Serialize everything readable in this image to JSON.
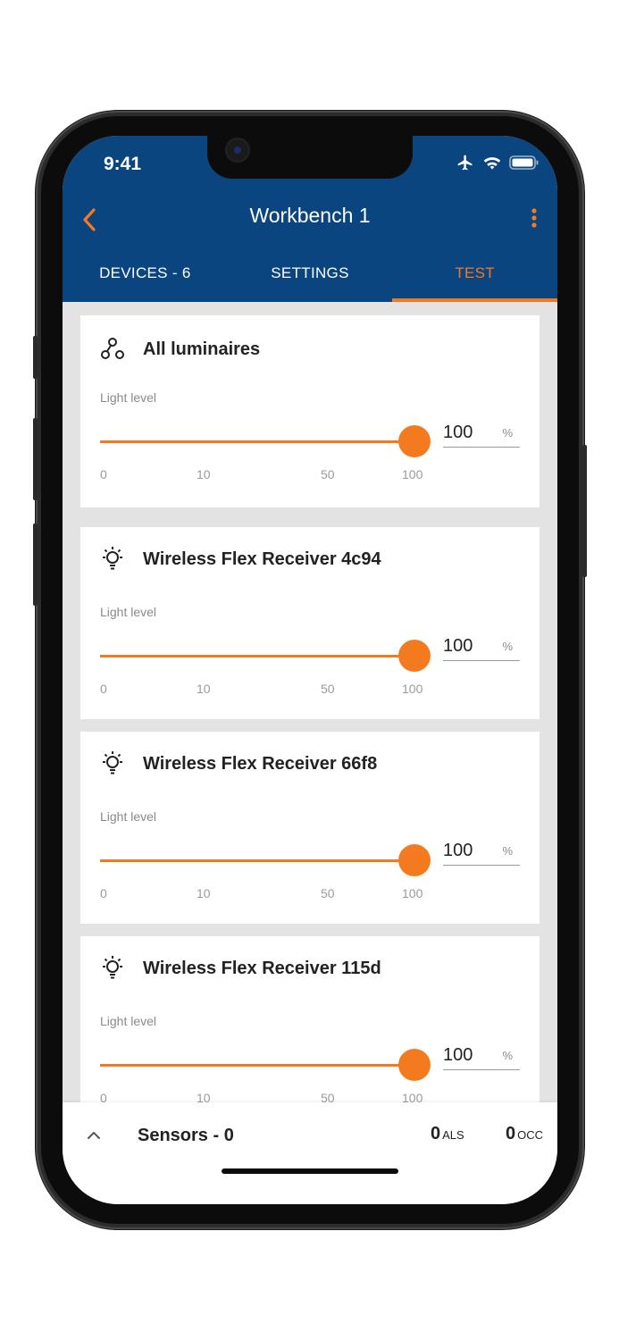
{
  "status_bar": {
    "time": "9:41"
  },
  "header": {
    "title": "Workbench 1"
  },
  "tabs": [
    {
      "label": "DEVICES - 6",
      "active": false
    },
    {
      "label": "SETTINGS",
      "active": false
    },
    {
      "label": "TEST",
      "active": true
    }
  ],
  "cards": [
    {
      "title": "All luminaires",
      "icon": "group-icon",
      "level_label": "Light level",
      "value": "100",
      "unit": "%",
      "ticks": [
        "0",
        "10",
        "50",
        "100"
      ],
      "level_percent": 100
    },
    {
      "title": "Wireless Flex Receiver 4c94",
      "icon": "bulb-icon",
      "level_label": "Light level",
      "value": "100",
      "unit": "%",
      "ticks": [
        "0",
        "10",
        "50",
        "100"
      ],
      "level_percent": 100
    },
    {
      "title": "Wireless Flex Receiver 66f8",
      "icon": "bulb-icon",
      "level_label": "Light level",
      "value": "100",
      "unit": "%",
      "ticks": [
        "0",
        "10",
        "50",
        "100"
      ],
      "level_percent": 100
    },
    {
      "title": "Wireless Flex Receiver 115d",
      "icon": "bulb-icon",
      "level_label": "Light level",
      "value": "100",
      "unit": "%",
      "ticks": [
        "0",
        "10",
        "50",
        "100"
      ],
      "level_percent": 100
    }
  ],
  "bottom_bar": {
    "label": "Sensors - 0",
    "als_count": "0",
    "als_unit": "ALS",
    "occ_count": "0",
    "occ_unit": "OCC"
  },
  "colors": {
    "header": "#0a4580",
    "accent": "#f47a1f",
    "background": "#e3e3e3"
  }
}
